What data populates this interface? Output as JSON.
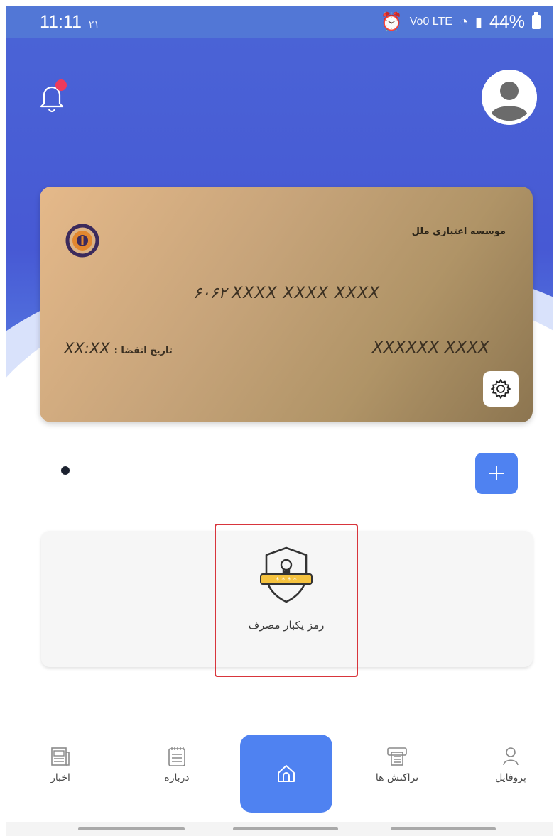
{
  "status_bar": {
    "time": "11:11",
    "time_suffix": "۲۱",
    "network_small": "Vo0 LTE",
    "battery": "44%"
  },
  "card": {
    "bank_name": "موسسه اعتباری ملل",
    "number": "۶۰۶۲ XXXX XXXX XXXX",
    "holder": "XXXXXX XXXX",
    "expiry_label": ": تاریخ انقضا",
    "expiry_value": "XX:XX"
  },
  "services": {
    "otp_label": "رمز یکبار مصرف"
  },
  "bottom_nav": {
    "items": [
      {
        "label": "اخبار",
        "icon": "newspaper-icon"
      },
      {
        "label": "درباره",
        "icon": "notepad-icon"
      },
      {
        "label": "",
        "icon": "home-icon"
      },
      {
        "label": "تراکنش ها",
        "icon": "transactions-icon"
      },
      {
        "label": "پروفایل",
        "icon": "user-icon"
      }
    ]
  },
  "colors": {
    "header_blue": "#4a63d6",
    "accent_blue": "#4f82f1",
    "notification_red": "#ee3a5b",
    "highlight_red": "#d8353c",
    "card_gold": "#c7a47a"
  }
}
